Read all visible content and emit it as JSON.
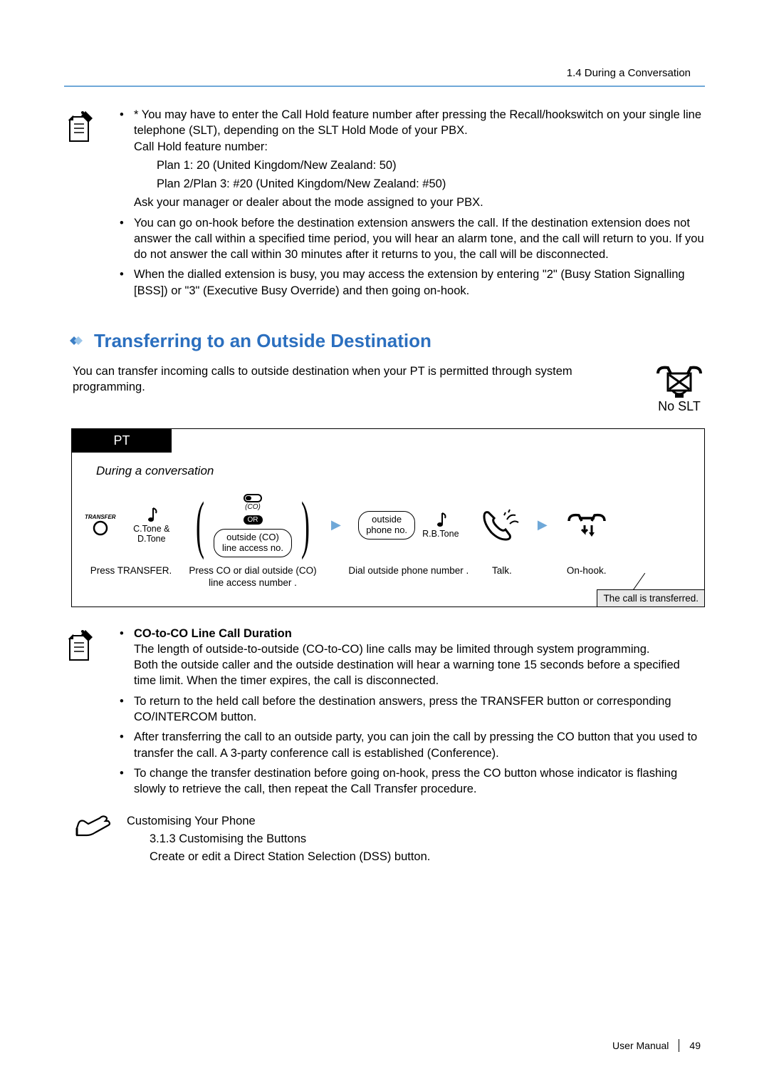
{
  "header": {
    "breadcrumb": "1.4 During a Conversation"
  },
  "note1": {
    "star_intro": "* You may have to enter the Call Hold feature number after pressing the Recall/hookswitch on your single line telephone (SLT), depending on the SLT Hold Mode of your PBX.",
    "feature_label": "Call Hold feature number:",
    "plan1": "Plan 1: 20 (United Kingdom/New Zealand: 50)",
    "plan2": "Plan 2/Plan 3: #20 (United Kingdom/New Zealand: #50)",
    "ask": "Ask your manager or dealer about the mode assigned to your PBX.",
    "bullet_onhook": "You can go on-hook before the destination extension answers the call. If the destination extension does not answer the call within a specified time period, you will hear an alarm tone, and the call will return to you. If you do not answer the call within 30 minutes after it returns to you, the call will be disconnected.",
    "bullet_busy": "When the dialled extension is busy, you may access the extension by entering \"2\" (Busy Station Signalling [BSS]) or \"3\" (Executive Busy Override) and then going on-hook."
  },
  "section": {
    "title": "Transferring to an Outside Destination",
    "intro": "You can transfer incoming calls to outside destination when your PT is permitted through system programming.",
    "noslt": "No SLT"
  },
  "diagram": {
    "pt_tab": "PT",
    "context": "During a conversation",
    "transfer_label": "TRANSFER",
    "tone1": "C.Tone & D.Tone",
    "step1_caption": "Press TRANSFER.",
    "co_small": "(CO)",
    "or": "OR",
    "pill_co": "outside (CO) line access no.",
    "step2_caption": "Press CO or dial outside (CO) line access number .",
    "pill_phone": "outside phone no.",
    "tone2": "R.B.Tone",
    "step3_caption": "Dial outside phone number .",
    "step4_caption": "Talk.",
    "step5_caption": "On-hook.",
    "result": "The call is transferred."
  },
  "note2": {
    "coco_title": "CO-to-CO Line Call Duration",
    "coco_p1": "The length of outside-to-outside (CO-to-CO) line calls may be limited through system programming.",
    "coco_p2": "Both the outside caller and the outside destination will hear a warning tone 15 seconds before a specified time limit. When the timer expires, the call is disconnected.",
    "return": "To return to the held call before the destination answers, press the TRANSFER button or corresponding CO/INTERCOM button.",
    "after": "After transferring the call to an outside party, you can join the call by pressing the CO button that you used to transfer the call. A 3-party conference call is established (Conference).",
    "change": "To change the transfer destination before going on-hook, press the CO button whose indicator is flashing slowly to retrieve the call, then repeat the Call Transfer procedure."
  },
  "customise": {
    "heading": "Customising Your Phone",
    "link": "3.1.3 Customising the Buttons",
    "desc": "Create or edit a Direct Station Selection (DSS) button."
  },
  "footer": {
    "manual": "User Manual",
    "page": "49"
  }
}
